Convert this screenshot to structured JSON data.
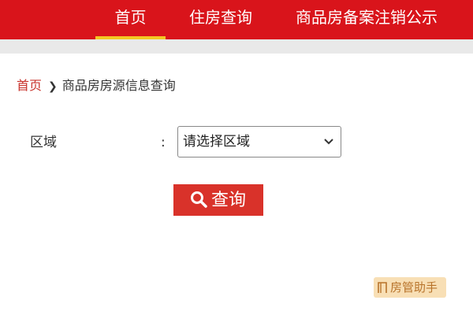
{
  "nav": {
    "home": "首页",
    "housing_query": "住房查询",
    "presale_notice": "商品房备案注销公示"
  },
  "breadcrumb": {
    "home": "首页",
    "current": "商品房房源信息查询"
  },
  "form": {
    "region_label": "区域",
    "colon": ":",
    "region_select_value": "请选择区域"
  },
  "search": {
    "label": "查询"
  },
  "watermark": {
    "text": "房管助手"
  },
  "colors": {
    "nav_bg": "#d9141b",
    "nav_active_underline": "#f3c623",
    "button_bg": "#d9322a",
    "breadcrumb_link": "#c8322b",
    "watermark_bg": "#f8dfb5"
  }
}
